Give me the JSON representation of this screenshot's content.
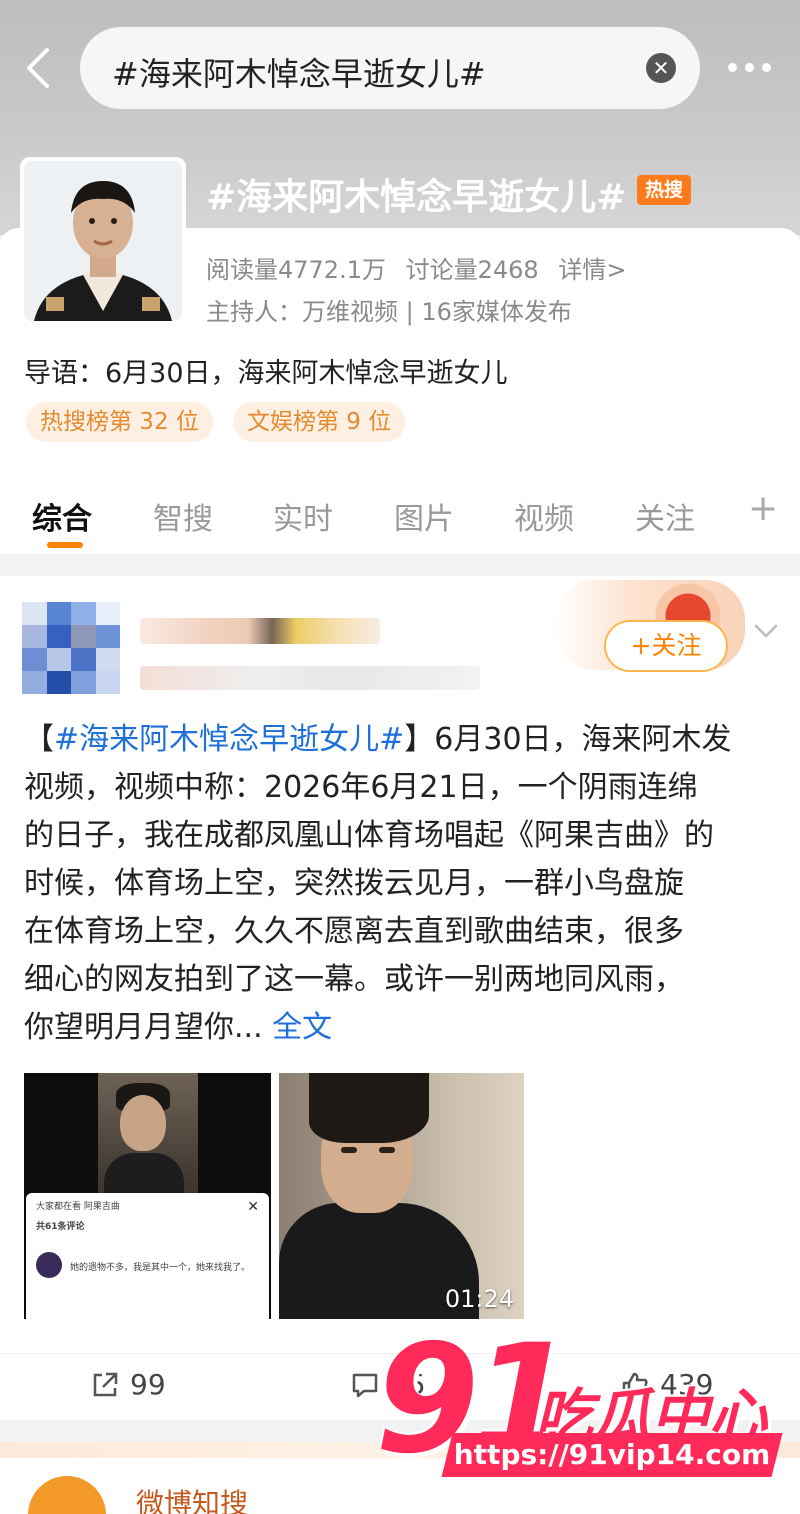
{
  "search": {
    "query": "#海来阿木悼念早逝女儿#"
  },
  "topic": {
    "title": "#海来阿木悼念早逝女儿#",
    "badge": "热搜",
    "reads": "阅读量4772.1万",
    "discussions": "讨论量2468",
    "details": "详情>",
    "host": "主持人：万维视频 | 16家媒体发布",
    "lead": "导语：6月30日，海来阿木悼念早逝女儿",
    "ranks": [
      "热搜榜第 32 位",
      "文娱榜第 9 位"
    ]
  },
  "tabs": [
    "综合",
    "智搜",
    "实时",
    "图片",
    "视频",
    "关注"
  ],
  "tab_add": "+",
  "post": {
    "follow_label": "+关注",
    "text_tag_open": "【",
    "text_tag": "#海来阿木悼念早逝女儿#",
    "text_tag_close": "】",
    "line1_rest": "6月30日，海来阿木发",
    "line2": "视频，视频中称：2026年6月21日，一个阴雨连绵",
    "line3": "的日子，我在成都凤凰山体育场唱起《阿果吉曲》的",
    "line4": "时候，体育场上空，突然拨云见月，一群小鸟盘旋",
    "line5": "在体育场上空，久久不愿离去直到歌曲结束，很多",
    "line6": "细心的网友拍到了这一幕。或许一别两地同风雨，",
    "line7": "你望明月月望你...",
    "full_text": "全文",
    "image1": {
      "sheet_title": "大家都在看  阿果吉曲",
      "sheet_count": "共61条评论",
      "comment": "她的遗物不多，我是其中一个，她来找我了。"
    },
    "image2_duration": "01:24",
    "reposts": "99",
    "comments": "65",
    "likes": "439"
  },
  "next_post": {
    "name": "微博知搜"
  },
  "watermark": {
    "num": "91",
    "cn": "吃瓜中心",
    "url": "https://91vip14.com"
  }
}
